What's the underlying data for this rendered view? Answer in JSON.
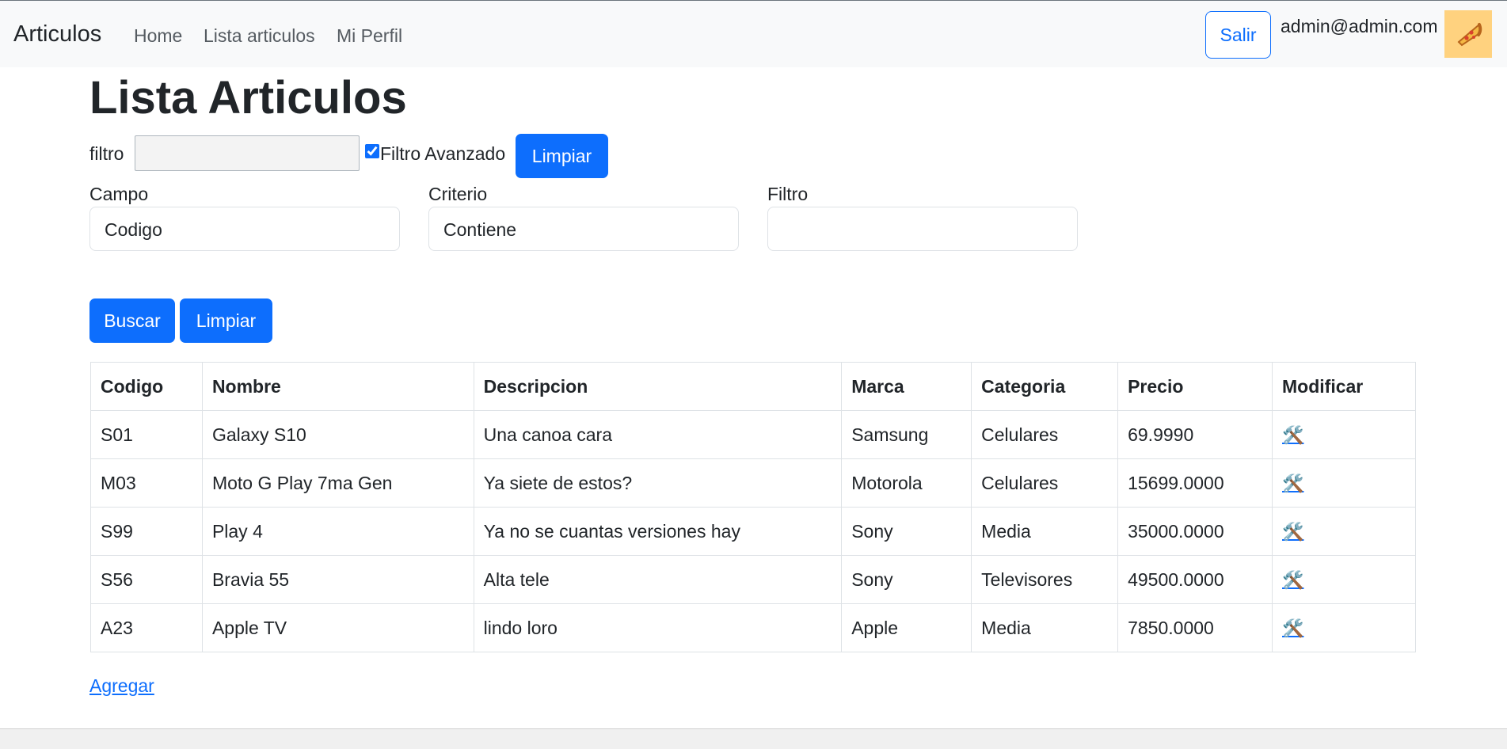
{
  "navbar": {
    "brand": "Articulos",
    "links": [
      "Home",
      "Lista articulos",
      "Mi Perfil"
    ],
    "logout_label": "Salir",
    "user_email": "admin@admin.com",
    "avatar_icon": "pizza-icon"
  },
  "page": {
    "title": "Lista Articulos"
  },
  "filter": {
    "label": "filtro",
    "value": "",
    "advanced_label": "Filtro Avanzado",
    "advanced_checked": true,
    "clear_label": "Limpiar"
  },
  "advanced": {
    "campo_label": "Campo",
    "campo_value": "Codigo",
    "criterio_label": "Criterio",
    "criterio_value": "Contiene",
    "filtro_label": "Filtro",
    "filtro_value": ""
  },
  "actions": {
    "search_label": "Buscar",
    "clear_label": "Limpiar",
    "add_label": "Agregar"
  },
  "table": {
    "headers": [
      "Codigo",
      "Nombre",
      "Descripcion",
      "Marca",
      "Categoria",
      "Precio",
      "Modificar"
    ],
    "edit_icon": "tools-icon",
    "rows": [
      [
        "S01",
        "Galaxy S10",
        "Una canoa cara",
        "Samsung",
        "Celulares",
        "69.9990"
      ],
      [
        "M03",
        "Moto G Play 7ma Gen",
        "Ya siete de estos?",
        "Motorola",
        "Celulares",
        "15699.0000"
      ],
      [
        "S99",
        "Play 4",
        "Ya no se cuantas versiones hay",
        "Sony",
        "Media",
        "35000.0000"
      ],
      [
        "S56",
        "Bravia 55",
        "Alta tele",
        "Sony",
        "Televisores",
        "49500.0000"
      ],
      [
        "A23",
        "Apple TV",
        "lindo loro",
        "Apple",
        "Media",
        "7850.0000"
      ]
    ]
  },
  "colors": {
    "primary": "#0d6efd",
    "navbar_bg": "#f8f9fa"
  }
}
